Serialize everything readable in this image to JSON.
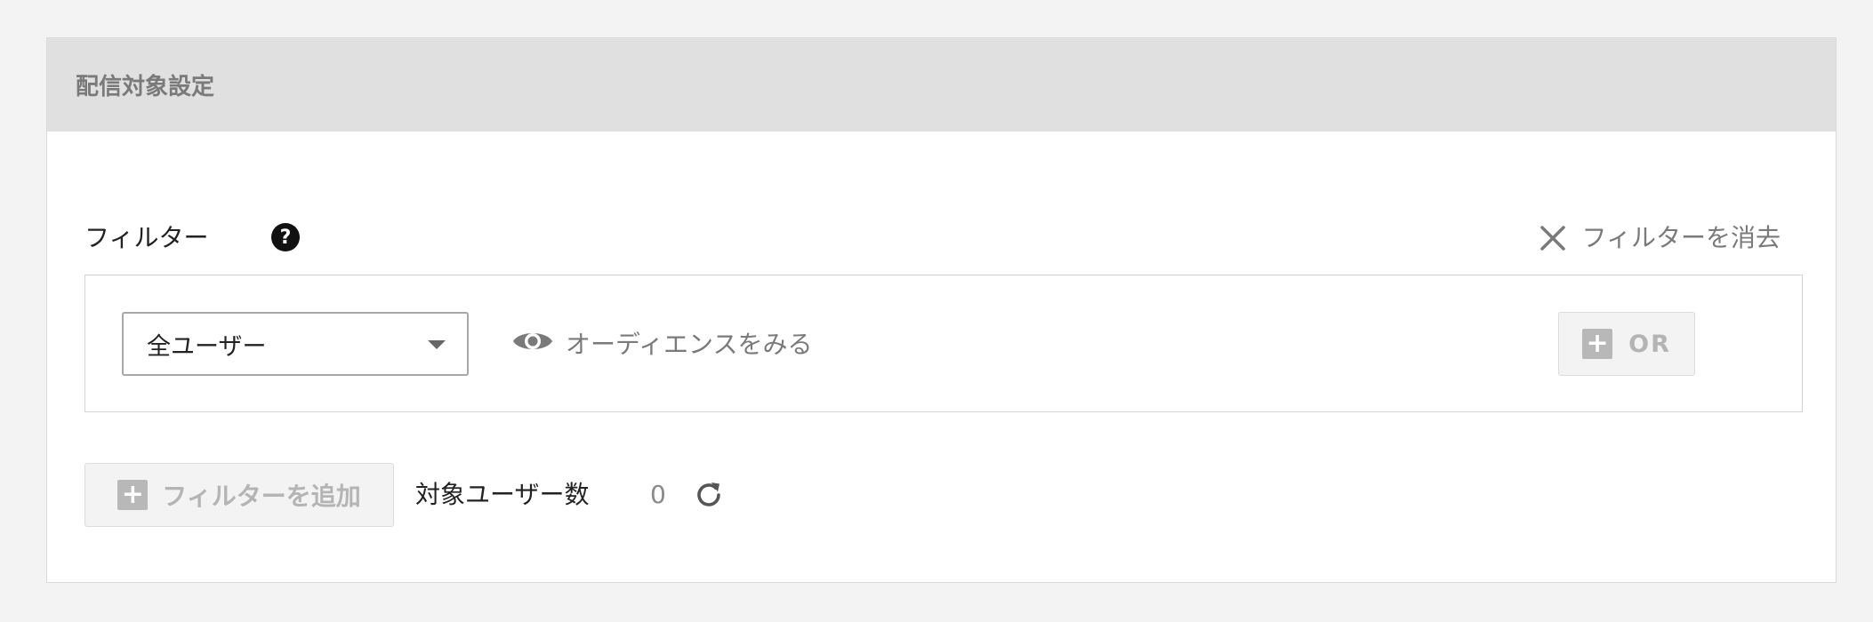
{
  "section": {
    "title": "配信対象設定"
  },
  "filter": {
    "label": "フィルター",
    "help_icon_glyph": "?",
    "clear_label": "フィルターを消去"
  },
  "filter_box": {
    "select_value": "全ユーザー",
    "audience_label": "オーディエンスをみる",
    "or_label": "OR"
  },
  "footer": {
    "add_filter_label": "フィルターを追加",
    "count_label": "対象ユーザー数",
    "count_value": "0"
  },
  "icons": {
    "help": "question-circle-icon",
    "clear": "close-icon",
    "select_caret": "caret-down-icon",
    "audience": "eye-icon",
    "add": "plus-square-icon",
    "refresh": "refresh-icon"
  },
  "colors": {
    "background": "#f3f3f3",
    "header": "#e0e0e0",
    "muted_text": "#7a7a7a",
    "disabled_text": "#b4b4b4"
  }
}
